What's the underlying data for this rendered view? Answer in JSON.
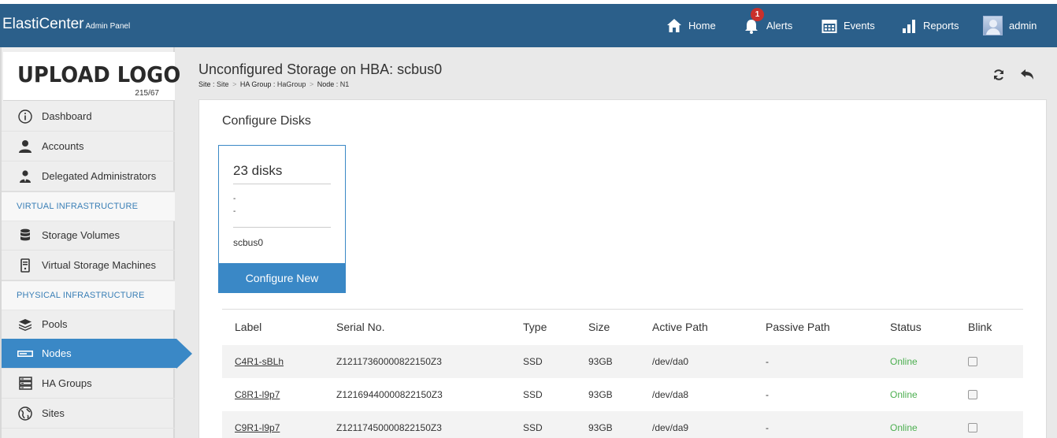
{
  "app": {
    "brand": "ElastiCenter",
    "brand_sub": "Admin Panel"
  },
  "topnav": {
    "home": "Home",
    "alerts": "Alerts",
    "alerts_count": "1",
    "events": "Events",
    "reports": "Reports",
    "user": "admin"
  },
  "sidebar": {
    "logo_text": "UPLOAD LOGO",
    "logo_count": "215/67",
    "items": [
      {
        "label": "Dashboard",
        "icon": "info-circle-icon"
      },
      {
        "label": "Accounts",
        "icon": "user-icon"
      },
      {
        "label": "Delegated Administrators",
        "icon": "user-tie-icon"
      }
    ],
    "section_virtual": "VIRTUAL INFRASTRUCTURE",
    "virtual_items": [
      {
        "label": "Storage Volumes",
        "icon": "database-icon"
      },
      {
        "label": "Virtual Storage Machines",
        "icon": "server-tower-icon"
      }
    ],
    "section_physical": "PHYSICAL INFRASTRUCTURE",
    "physical_items": [
      {
        "label": "Pools",
        "icon": "layers-icon"
      },
      {
        "label": "Nodes",
        "icon": "node-bar-icon",
        "active": true
      },
      {
        "label": "HA Groups",
        "icon": "server-stack-icon"
      },
      {
        "label": "Sites",
        "icon": "globe-icon"
      }
    ],
    "accent": "#3a88c6"
  },
  "page": {
    "title": "Unconfigured Storage on HBA: scbus0",
    "breadcrumb": [
      {
        "key": "Site",
        "value": "Site"
      },
      {
        "key": "HA Group",
        "value": "HaGroup"
      },
      {
        "key": "Node",
        "value": "N1"
      }
    ]
  },
  "configure": {
    "heading": "Configure Disks",
    "card": {
      "disks": "23 disks",
      "line1": "-",
      "line2": "-",
      "hba": "scbus0",
      "button": "Configure New"
    }
  },
  "table": {
    "headers": [
      "Label",
      "Serial No.",
      "Type",
      "Size",
      "Active Path",
      "Passive Path",
      "Status",
      "Blink"
    ],
    "rows": [
      {
        "label": "C4R1-sBLh",
        "serial": "Z12117360000822150Z3",
        "type": "SSD",
        "size": "93GB",
        "active": "/dev/da0",
        "passive": "-",
        "status": "Online",
        "blink": false
      },
      {
        "label": "C8R1-l9p7",
        "serial": "Z12169440000822150Z3",
        "type": "SSD",
        "size": "93GB",
        "active": "/dev/da8",
        "passive": "-",
        "status": "Online",
        "blink": false
      },
      {
        "label": "C9R1-l9p7",
        "serial": "Z12117450000822150Z3",
        "type": "SSD",
        "size": "93GB",
        "active": "/dev/da9",
        "passive": "-",
        "status": "Online",
        "blink": false
      }
    ],
    "status_color": "#4caf50"
  },
  "colors": {
    "topbar": "#2b5f8a",
    "accent": "#3a88c6"
  }
}
